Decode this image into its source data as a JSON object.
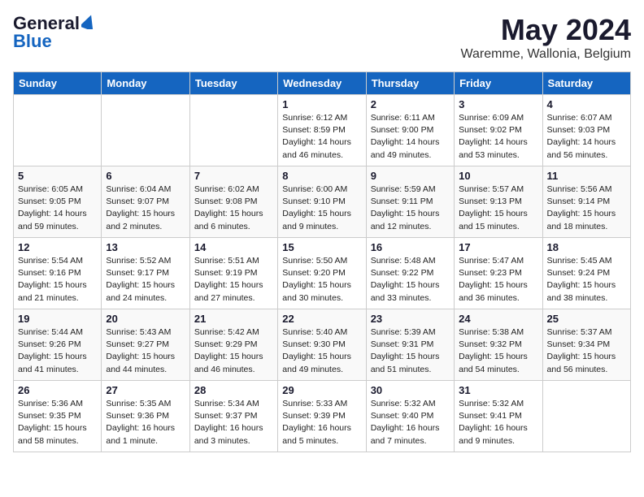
{
  "header": {
    "logo_general": "General",
    "logo_blue": "Blue",
    "month_year": "May 2024",
    "location": "Waremme, Wallonia, Belgium"
  },
  "days_of_week": [
    "Sunday",
    "Monday",
    "Tuesday",
    "Wednesday",
    "Thursday",
    "Friday",
    "Saturday"
  ],
  "weeks": [
    [
      {
        "day": "",
        "info": ""
      },
      {
        "day": "",
        "info": ""
      },
      {
        "day": "",
        "info": ""
      },
      {
        "day": "1",
        "info": "Sunrise: 6:12 AM\nSunset: 8:59 PM\nDaylight: 14 hours\nand 46 minutes."
      },
      {
        "day": "2",
        "info": "Sunrise: 6:11 AM\nSunset: 9:00 PM\nDaylight: 14 hours\nand 49 minutes."
      },
      {
        "day": "3",
        "info": "Sunrise: 6:09 AM\nSunset: 9:02 PM\nDaylight: 14 hours\nand 53 minutes."
      },
      {
        "day": "4",
        "info": "Sunrise: 6:07 AM\nSunset: 9:03 PM\nDaylight: 14 hours\nand 56 minutes."
      }
    ],
    [
      {
        "day": "5",
        "info": "Sunrise: 6:05 AM\nSunset: 9:05 PM\nDaylight: 14 hours\nand 59 minutes."
      },
      {
        "day": "6",
        "info": "Sunrise: 6:04 AM\nSunset: 9:07 PM\nDaylight: 15 hours\nand 2 minutes."
      },
      {
        "day": "7",
        "info": "Sunrise: 6:02 AM\nSunset: 9:08 PM\nDaylight: 15 hours\nand 6 minutes."
      },
      {
        "day": "8",
        "info": "Sunrise: 6:00 AM\nSunset: 9:10 PM\nDaylight: 15 hours\nand 9 minutes."
      },
      {
        "day": "9",
        "info": "Sunrise: 5:59 AM\nSunset: 9:11 PM\nDaylight: 15 hours\nand 12 minutes."
      },
      {
        "day": "10",
        "info": "Sunrise: 5:57 AM\nSunset: 9:13 PM\nDaylight: 15 hours\nand 15 minutes."
      },
      {
        "day": "11",
        "info": "Sunrise: 5:56 AM\nSunset: 9:14 PM\nDaylight: 15 hours\nand 18 minutes."
      }
    ],
    [
      {
        "day": "12",
        "info": "Sunrise: 5:54 AM\nSunset: 9:16 PM\nDaylight: 15 hours\nand 21 minutes."
      },
      {
        "day": "13",
        "info": "Sunrise: 5:52 AM\nSunset: 9:17 PM\nDaylight: 15 hours\nand 24 minutes."
      },
      {
        "day": "14",
        "info": "Sunrise: 5:51 AM\nSunset: 9:19 PM\nDaylight: 15 hours\nand 27 minutes."
      },
      {
        "day": "15",
        "info": "Sunrise: 5:50 AM\nSunset: 9:20 PM\nDaylight: 15 hours\nand 30 minutes."
      },
      {
        "day": "16",
        "info": "Sunrise: 5:48 AM\nSunset: 9:22 PM\nDaylight: 15 hours\nand 33 minutes."
      },
      {
        "day": "17",
        "info": "Sunrise: 5:47 AM\nSunset: 9:23 PM\nDaylight: 15 hours\nand 36 minutes."
      },
      {
        "day": "18",
        "info": "Sunrise: 5:45 AM\nSunset: 9:24 PM\nDaylight: 15 hours\nand 38 minutes."
      }
    ],
    [
      {
        "day": "19",
        "info": "Sunrise: 5:44 AM\nSunset: 9:26 PM\nDaylight: 15 hours\nand 41 minutes."
      },
      {
        "day": "20",
        "info": "Sunrise: 5:43 AM\nSunset: 9:27 PM\nDaylight: 15 hours\nand 44 minutes."
      },
      {
        "day": "21",
        "info": "Sunrise: 5:42 AM\nSunset: 9:29 PM\nDaylight: 15 hours\nand 46 minutes."
      },
      {
        "day": "22",
        "info": "Sunrise: 5:40 AM\nSunset: 9:30 PM\nDaylight: 15 hours\nand 49 minutes."
      },
      {
        "day": "23",
        "info": "Sunrise: 5:39 AM\nSunset: 9:31 PM\nDaylight: 15 hours\nand 51 minutes."
      },
      {
        "day": "24",
        "info": "Sunrise: 5:38 AM\nSunset: 9:32 PM\nDaylight: 15 hours\nand 54 minutes."
      },
      {
        "day": "25",
        "info": "Sunrise: 5:37 AM\nSunset: 9:34 PM\nDaylight: 15 hours\nand 56 minutes."
      }
    ],
    [
      {
        "day": "26",
        "info": "Sunrise: 5:36 AM\nSunset: 9:35 PM\nDaylight: 15 hours\nand 58 minutes."
      },
      {
        "day": "27",
        "info": "Sunrise: 5:35 AM\nSunset: 9:36 PM\nDaylight: 16 hours\nand 1 minute."
      },
      {
        "day": "28",
        "info": "Sunrise: 5:34 AM\nSunset: 9:37 PM\nDaylight: 16 hours\nand 3 minutes."
      },
      {
        "day": "29",
        "info": "Sunrise: 5:33 AM\nSunset: 9:39 PM\nDaylight: 16 hours\nand 5 minutes."
      },
      {
        "day": "30",
        "info": "Sunrise: 5:32 AM\nSunset: 9:40 PM\nDaylight: 16 hours\nand 7 minutes."
      },
      {
        "day": "31",
        "info": "Sunrise: 5:32 AM\nSunset: 9:41 PM\nDaylight: 16 hours\nand 9 minutes."
      },
      {
        "day": "",
        "info": ""
      }
    ]
  ]
}
